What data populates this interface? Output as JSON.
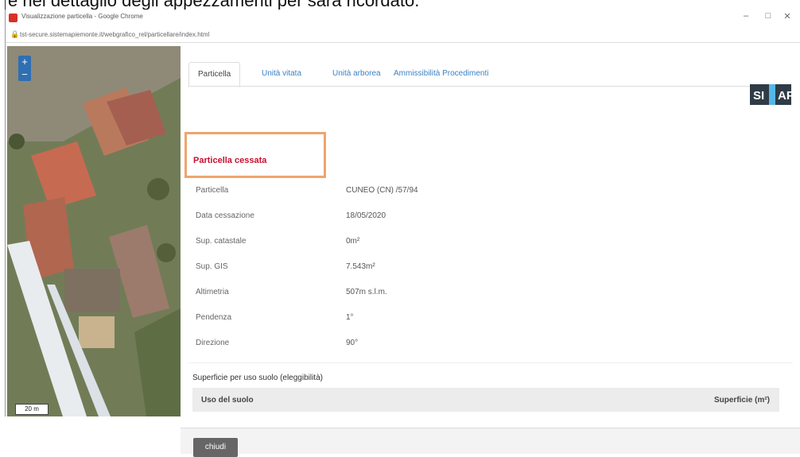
{
  "caption": "e nel dettaglio degli appezzamenti per sarà ricordato.",
  "window": {
    "title": "Visualizzazione particella - Google Chrome",
    "url": "tst-secure.sistemapiemonte.it/webgrafico_rel/particellare/index.html",
    "controls": [
      "–",
      "□",
      "✕"
    ]
  },
  "map": {
    "zoom_in": "+",
    "zoom_out": "−",
    "scale": "20 m"
  },
  "tabs": [
    "Particella",
    "Unità vitata",
    "Unità arborea",
    "Ammissibilità Procedimenti"
  ],
  "logo": {
    "left": "SI",
    "right": "AP"
  },
  "status": "Particella cessata",
  "details": [
    {
      "label": "Particella",
      "value": "CUNEO (CN) /57/94"
    },
    {
      "label": "Data cessazione",
      "value": "18/05/2020"
    },
    {
      "label": "Sup. catastale",
      "value": "0m²"
    },
    {
      "label": "Sup. GIS",
      "value": "7.543m²"
    },
    {
      "label": "Altimetria",
      "value": "507m s.l.m."
    },
    {
      "label": "Pendenza",
      "value": "1°"
    },
    {
      "label": "Direzione",
      "value": "90°"
    }
  ],
  "section": {
    "title": "Superficie per uso suolo (eleggibilità)",
    "col_left": "Uso del suolo",
    "col_right": "Superficie (m²)"
  },
  "footer": {
    "close_label": "chiudi"
  },
  "colors": {
    "accent": "#3b82c4",
    "status": "#c8102e",
    "highlight": "#f0a46c"
  }
}
